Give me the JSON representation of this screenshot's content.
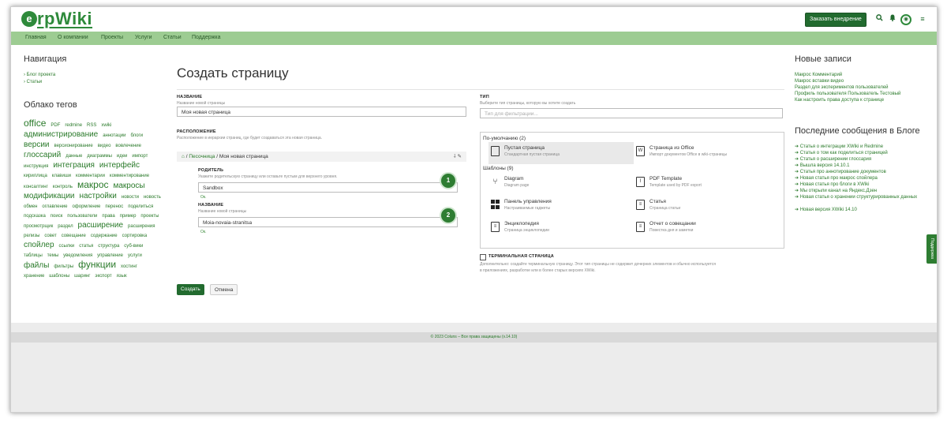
{
  "header": {
    "logo_mark": "e",
    "logo_text": "rpWiki",
    "cta": "Заказать внедрение",
    "icons": [
      "search-icon",
      "bell-icon",
      "globe-icon",
      "menu-icon"
    ]
  },
  "menu": [
    "Главная",
    "О компании",
    "Проекты",
    "Услуги",
    "Статьи",
    "Поддержка"
  ],
  "left_sidebar": {
    "nav_title": "Навигация",
    "nav_items": [
      "› Блог проекта",
      "› Статьи"
    ],
    "tags_title": "Облако тегов",
    "tags": [
      [
        "office",
        5
      ],
      [
        "PDF",
        1
      ],
      [
        "redmine",
        1
      ],
      [
        "RSS",
        1
      ],
      [
        "xwiki",
        1
      ],
      [
        "администрирование",
        4
      ],
      [
        "аннотации",
        1
      ],
      [
        "блоги",
        1
      ],
      [
        "версии",
        4
      ],
      [
        "версионирование",
        1
      ],
      [
        "видео",
        1
      ],
      [
        "вовлечение",
        1
      ],
      [
        "глоссарий",
        4
      ],
      [
        "данные",
        1
      ],
      [
        "диаграммы",
        1
      ],
      [
        "идеи",
        1
      ],
      [
        "импорт",
        1
      ],
      [
        "инструкция",
        1
      ],
      [
        "интеграция",
        4
      ],
      [
        "интерфейс",
        4
      ],
      [
        "кириллица",
        1
      ],
      [
        "клавиши",
        1
      ],
      [
        "комментарии",
        1
      ],
      [
        "комментирование",
        1
      ],
      [
        "консалтинг",
        1
      ],
      [
        "контроль",
        1
      ],
      [
        "макрос",
        5
      ],
      [
        "макросы",
        4
      ],
      [
        "модификации",
        4
      ],
      [
        "настройки",
        4
      ],
      [
        "новости",
        1
      ],
      [
        "новость",
        1
      ],
      [
        "обмен",
        1
      ],
      [
        "оглавление",
        1
      ],
      [
        "оформление",
        1
      ],
      [
        "перенос",
        1
      ],
      [
        "поделиться",
        1
      ],
      [
        "подсказка",
        1
      ],
      [
        "поиск",
        1
      ],
      [
        "пользователи",
        1
      ],
      [
        "права",
        1
      ],
      [
        "пример",
        1
      ],
      [
        "проекты",
        1
      ],
      [
        "просмотрщик",
        1
      ],
      [
        "раздел",
        1
      ],
      [
        "расширение",
        4
      ],
      [
        "расширения",
        1
      ],
      [
        "релизы",
        1
      ],
      [
        "совет",
        1
      ],
      [
        "совещание",
        1
      ],
      [
        "содержание",
        1
      ],
      [
        "сортировка",
        1
      ],
      [
        "спойлер",
        4
      ],
      [
        "ссылки",
        1
      ],
      [
        "статья",
        1
      ],
      [
        "структура",
        1
      ],
      [
        "суб-вики",
        1
      ],
      [
        "таблицы",
        1
      ],
      [
        "темы",
        1
      ],
      [
        "уведомления",
        1
      ],
      [
        "управление",
        1
      ],
      [
        "услуги",
        1
      ],
      [
        "файлы",
        4
      ],
      [
        "фильтры",
        1
      ],
      [
        "функции",
        5
      ],
      [
        "хостинг",
        1
      ],
      [
        "хранение",
        1
      ],
      [
        "шаблоны",
        1
      ],
      [
        "шаринг",
        1
      ],
      [
        "экспорт",
        1
      ],
      [
        "язык",
        1
      ]
    ]
  },
  "form": {
    "page_title": "Создать страницу",
    "name_label": "НАЗВАНИЕ",
    "name_hint": "Название новой страницы",
    "name_value": "Моя новая страница",
    "location_label": "РАСПОЛОЖЕНИЕ",
    "location_hint": "Расположение в иерархии страниц, где будет создаваться эта новая страница.",
    "breadcrumb_parent": "Песочница",
    "breadcrumb_sep": " / ",
    "breadcrumb_current": "Моя новая страница",
    "parent_label": "РОДИТЕЛЬ",
    "parent_hint": "Укажите родительскую страницу или оставьте пустым для верхнего уровня.",
    "parent_value": "Sandbox",
    "ok": "Ок.",
    "name2_label": "НАЗВАНИЕ",
    "name2_hint": "Название новой страницы",
    "name2_value": "Moia-novaia-stranitsa",
    "step1": "1",
    "step2": "2",
    "create": "Создать",
    "cancel": "Отмена"
  },
  "type_section": {
    "label": "ТИП",
    "hint": "Выберите тип страницы, которую вы хотите создать",
    "filter_placeholder": "Тип для фильтрации...",
    "group_default": "По-умолчанию (2)",
    "group_templates": "Шаблоны (9)",
    "tiles": [
      {
        "name": "Пустая страница",
        "desc": "Стандартная пустая страница",
        "icon": "blank-doc-icon"
      },
      {
        "name": "Страница из Office",
        "desc": "Импорт документов Office в wiki-страницы",
        "icon": "word-doc-icon"
      },
      {
        "name": "Diagram",
        "desc": "Diagram page",
        "icon": "diagram-icon"
      },
      {
        "name": "PDF Template",
        "desc": "Template used by PDF export",
        "icon": "pdf-icon"
      },
      {
        "name": "Панель управления",
        "desc": "Настраиваемые гаджеты",
        "icon": "dashboard-icon"
      },
      {
        "name": "Статья",
        "desc": "Страница статьи",
        "icon": "article-icon"
      },
      {
        "name": "Энциклопедия",
        "desc": "Страница энциклопедии",
        "icon": "encyclopedia-icon"
      },
      {
        "name": "Отчет о совещании",
        "desc": "Повестка дня и заметки",
        "icon": "meeting-icon"
      }
    ],
    "terminal_label": "ТЕРМИНАЛЬНАЯ СТРАНИЦА",
    "terminal_hint_1": "Дополнительно: создайте терминальную страницу. Этот тип страницы не содержит дочерних элементов и обычно используется",
    "terminal_hint_2": "в приложениях, разработке или в более старых версиях XWiki."
  },
  "right_sidebar": {
    "recent_title": "Новые записи",
    "recent": [
      "Макрос Комментарий",
      "Макрос вставки видео",
      "Раздел для экспериментов пользователей",
      "Профиль пользователя Пользователь Тестовый",
      "Как настроить права доступа к странице"
    ],
    "blog_title": "Последние сообщения в Блоге",
    "posts": [
      "➔ Статья о интеграции XWiki и Redmine",
      "➔ Статья о том как поделиться страницей",
      "➔ Статья о расширении глоссария",
      "➔ Вышла версия 14.10.1",
      "➔ Статья про аннотирование документов",
      "➔ Новая статья про макрос спойлера",
      "➔ Новая статья про блоги в XWiki",
      "➔ Мы открыли канал на Яндекс.Дзен",
      "➔ Новая статья о хранении структурированных данных",
      "➔ Новая версия XWiki 14.10"
    ],
    "feedback": "Поддержка"
  },
  "footer": "© 2023 Coluns – Все права защищены (v.14.10)"
}
